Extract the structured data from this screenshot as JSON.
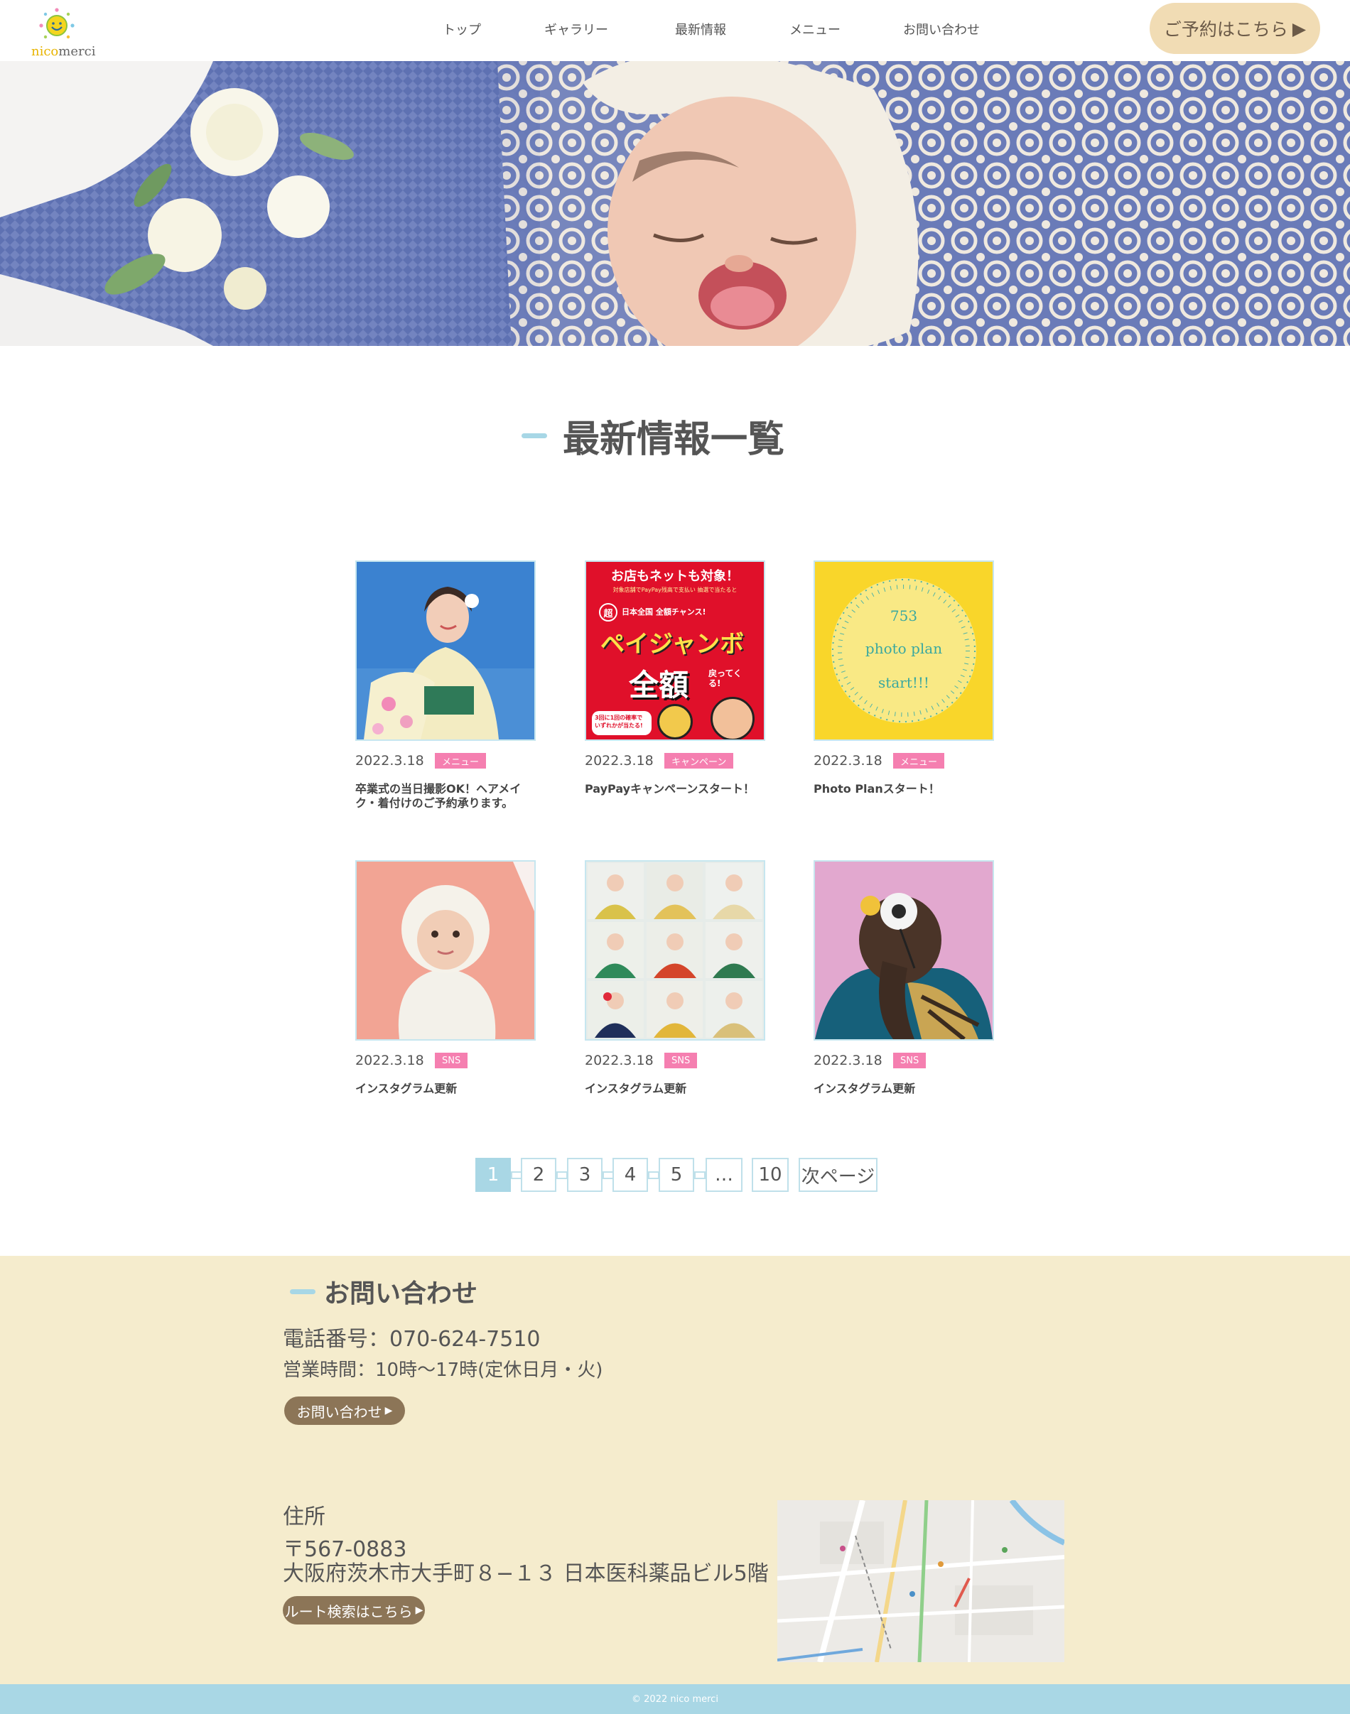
{
  "header": {
    "logo": {
      "nico": "nico",
      "merci": "merci",
      "icon": "smiling-sun-icon"
    },
    "nav": [
      "トップ",
      "ギャラリー",
      "最新情報",
      "メニュー",
      "お問い合わせ"
    ],
    "reserve_label": "ご予約はこちら"
  },
  "page_title": "最新情報一覧",
  "news": [
    {
      "date": "2022.3.18",
      "tag": "メニュー",
      "title": "卒業式の当日撮影OK！ヘアメイク・着付けのご予約承ります。"
    },
    {
      "date": "2022.3.18",
      "tag": "キャンペーン",
      "title": "PayPayキャンペーンスタート！"
    },
    {
      "date": "2022.3.18",
      "tag": "メニュー",
      "title": "Photo Planスタート！"
    },
    {
      "date": "2022.3.18",
      "tag": "SNS",
      "title": "インスタグラム更新"
    },
    {
      "date": "2022.3.18",
      "tag": "SNS",
      "title": "インスタグラム更新"
    },
    {
      "date": "2022.3.18",
      "tag": "SNS",
      "title": "インスタグラム更新"
    }
  ],
  "paypay_banner": {
    "top": "お店もネットも対象！",
    "sub": "対象店舗でPayPay残高で支払い 抽選で当たると",
    "chip": "超",
    "line": "日本全国 全額チャンス!",
    "big": "ペイジャンボ",
    "amount": "全額",
    "back": "戻ってくる!",
    "odds": "3回に1回の確率で いずれかが当たる!"
  },
  "photo_plan": {
    "line1": "753",
    "line2": "photo plan",
    "line3": "start!!!"
  },
  "pagination": {
    "pages": [
      "1",
      "2",
      "3",
      "4",
      "5",
      "…",
      "10"
    ],
    "next": "次ページ",
    "current": "1"
  },
  "contact": {
    "heading": "お問い合わせ",
    "phone": "電話番号：070-624-7510",
    "hours": "営業時間：10時〜17時(定休日月・火)",
    "button": "お問い合わせ",
    "address_label": "住所",
    "postal": "〒567-0883",
    "address": "大阪府茨木市大手町８−１３ 日本医科薬品ビル5階",
    "route_button": "ルート検索はこちら"
  },
  "copyright": "© 2022 nico merci",
  "colors": {
    "accent_blue": "#a9d7e5",
    "tag_pink": "#f57fb0",
    "footer_beige": "#f5eccd",
    "reserve_beige": "#f1dcb4",
    "button_brown": "#8c7557"
  }
}
